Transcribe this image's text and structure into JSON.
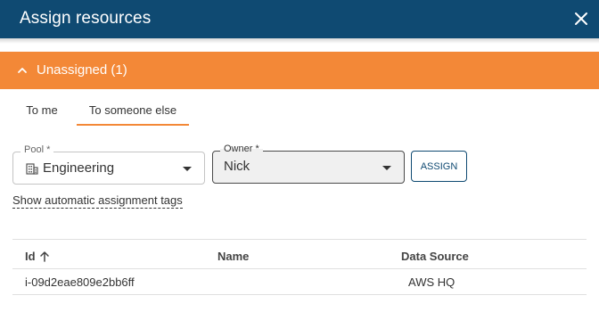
{
  "dialog": {
    "title": "Assign resources"
  },
  "section": {
    "label": "Unassigned (1)"
  },
  "tabs": [
    {
      "label": "To me",
      "active": false
    },
    {
      "label": "To someone else",
      "active": true
    }
  ],
  "form": {
    "pool": {
      "label": "Pool *",
      "value": "Engineering"
    },
    "owner": {
      "label": "Owner *",
      "value": "Nick"
    },
    "assign_label": "ASSIGN",
    "tags_link": "Show automatic assignment tags"
  },
  "table": {
    "columns": [
      "Id",
      "Name",
      "Data Source"
    ],
    "rows": [
      {
        "id": "i-09d2eae809e2bb6ff",
        "name": "",
        "data_source": "AWS HQ"
      }
    ]
  },
  "colors": {
    "header_bg": "#0f4a72",
    "accent_orange": "#f38837"
  },
  "icons": {
    "close": "close-icon",
    "chevron": "chevron-up-icon",
    "pool": "building-icon",
    "sort": "arrow-up-icon"
  }
}
